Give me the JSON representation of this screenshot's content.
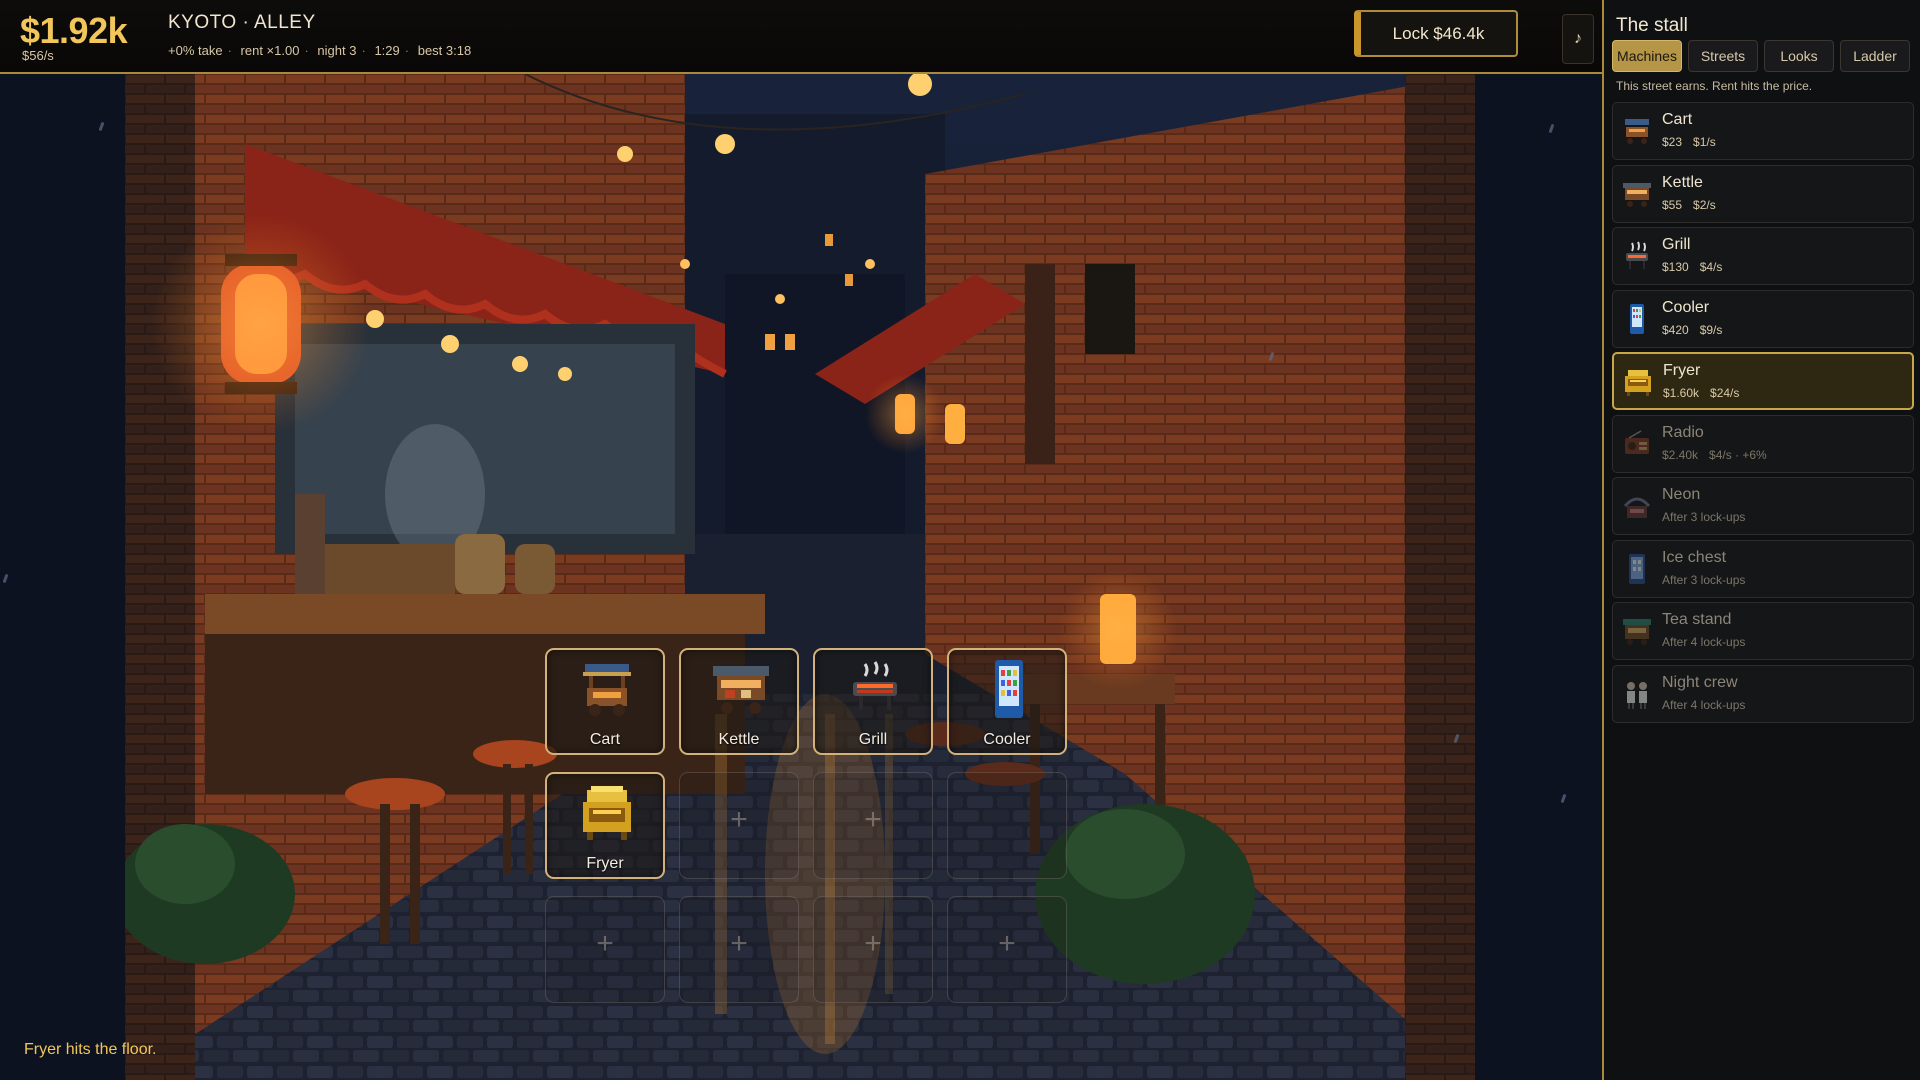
{
  "header": {
    "money": "$1.92k",
    "rate": "$56/s",
    "location": "KYOTO · ALLEY",
    "stats": [
      "+0% take",
      "rent ×1.00",
      "night 3",
      "1:29",
      "best 3:18"
    ],
    "lock_label": "Lock  $46.4k",
    "music_label": "♪"
  },
  "grid": {
    "slots": [
      {
        "label": "Cart",
        "icon": "cart-icon"
      },
      {
        "label": "Kettle",
        "icon": "kettle-icon"
      },
      {
        "label": "Grill",
        "icon": "grill-icon"
      },
      {
        "label": "Cooler",
        "icon": "cooler-icon"
      },
      {
        "label": "Fryer",
        "icon": "fryer-icon"
      },
      {
        "label": "+"
      },
      {
        "label": "+"
      },
      {
        "label": ""
      },
      {
        "label": "+"
      },
      {
        "label": "+"
      },
      {
        "label": "+"
      },
      {
        "label": "+"
      }
    ]
  },
  "toast": "Fryer hits the floor.",
  "panel": {
    "title": "The stall",
    "tabs": [
      "Machines",
      "Streets",
      "Looks",
      "Ladder"
    ],
    "active_tab": "Machines",
    "hint": "This street earns. Rent hits the price.",
    "items": [
      {
        "name": "Cart",
        "price": "$23",
        "rate": "$1/s",
        "icon": "cart-icon",
        "state": "available"
      },
      {
        "name": "Kettle",
        "price": "$55",
        "rate": "$2/s",
        "icon": "kettle-icon",
        "state": "available"
      },
      {
        "name": "Grill",
        "price": "$130",
        "rate": "$4/s",
        "icon": "grill-icon",
        "state": "available"
      },
      {
        "name": "Cooler",
        "price": "$420",
        "rate": "$9/s",
        "icon": "cooler-icon",
        "state": "available"
      },
      {
        "name": "Fryer",
        "price": "$1.60k",
        "rate": "$24/s",
        "icon": "fryer-icon",
        "state": "selected"
      },
      {
        "name": "Radio",
        "price": "$2.40k",
        "rate": "$4/s · +6%",
        "icon": "radio-icon",
        "state": "locked"
      },
      {
        "name": "Neon",
        "price": "After 3 lock-ups",
        "rate": "",
        "icon": "neon-icon",
        "state": "locked"
      },
      {
        "name": "Ice chest",
        "price": "After 3 lock-ups",
        "rate": "",
        "icon": "ice-chest-icon",
        "state": "locked"
      },
      {
        "name": "Tea stand",
        "price": "After 4 lock-ups",
        "rate": "",
        "icon": "tea-stand-icon",
        "state": "locked"
      },
      {
        "name": "Night crew",
        "price": "After 4 lock-ups",
        "rate": "",
        "icon": "night-crew-icon",
        "state": "locked"
      }
    ]
  },
  "colors": {
    "accent_gold": "#f1c65a",
    "border_gold": "#a98a3c",
    "selected_tab": "#b59646",
    "lantern": "#ff8a2a"
  }
}
